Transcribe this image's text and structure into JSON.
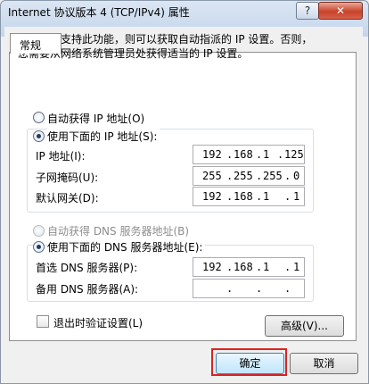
{
  "window": {
    "title": "Internet 协议版本 4 (TCP/IPv4) 属性",
    "help_label": "?",
    "close_label": "✕"
  },
  "tab": {
    "label": "常规"
  },
  "description": {
    "line1": "如果网络支持此功能，则可以获取自动指派的 IP 设置。否则，",
    "line2": "您需要从网络系统管理员处获得适当的 IP 设置。"
  },
  "ip_mode": {
    "auto_label": "自动获得 IP 地址(O)",
    "manual_label": "使用下面的 IP 地址(S):",
    "selected": "manual"
  },
  "ip_fields": [
    {
      "label": "IP 地址(I):",
      "octets": [
        "192",
        "168",
        "1",
        "125"
      ]
    },
    {
      "label": "子网掩码(U):",
      "octets": [
        "255",
        "255",
        "255",
        "0"
      ]
    },
    {
      "label": "默认网关(D):",
      "octets": [
        "192",
        "168",
        "1",
        "1"
      ]
    }
  ],
  "dns_mode": {
    "auto_label": "自动获得 DNS 服务器地址(B)",
    "manual_label": "使用下面的 DNS 服务器地址(E):",
    "selected": "manual"
  },
  "dns_fields": [
    {
      "label": "首选 DNS 服务器(P):",
      "octets": [
        "192",
        "168",
        "1",
        "1"
      ]
    },
    {
      "label": "备用 DNS 服务器(A):",
      "octets": [
        "",
        "",
        "",
        ""
      ]
    }
  ],
  "validate": {
    "label": "退出时验证设置(L)",
    "checked": false
  },
  "buttons": {
    "advanced": "高级(V)...",
    "ok": "确定",
    "cancel": "取消"
  },
  "colors": {
    "highlight": "#e02020"
  }
}
